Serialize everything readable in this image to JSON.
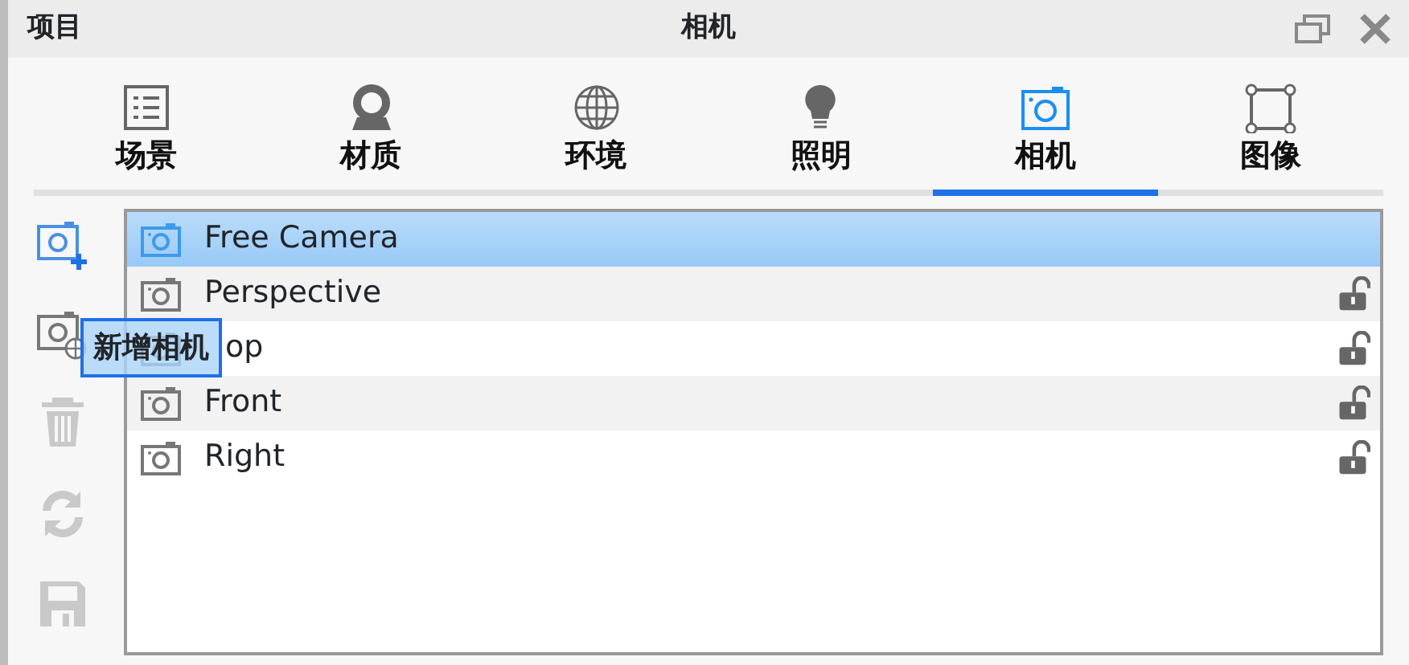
{
  "title_bar": {
    "left_label": "项目",
    "title": "相机"
  },
  "tabs": [
    {
      "label": "场景",
      "kind": "list",
      "selected": false
    },
    {
      "label": "材质",
      "kind": "material",
      "selected": false
    },
    {
      "label": "环境",
      "kind": "globe",
      "selected": false
    },
    {
      "label": "照明",
      "kind": "bulb",
      "selected": false
    },
    {
      "label": "相机",
      "kind": "camera",
      "selected": true
    },
    {
      "label": "图像",
      "kind": "frame",
      "selected": false
    }
  ],
  "toolbar": [
    {
      "kind": "add-camera",
      "disabled": false
    },
    {
      "kind": "camera-globe",
      "disabled": false
    },
    {
      "kind": "trash",
      "disabled": true
    },
    {
      "kind": "refresh",
      "disabled": true
    },
    {
      "kind": "save",
      "disabled": true
    }
  ],
  "tooltip": "新增相机",
  "cameras": [
    {
      "name": "Free Camera",
      "selected": true
    },
    {
      "name": "Perspective",
      "selected": false,
      "locked": false
    },
    {
      "name": "op",
      "selected": false,
      "locked": false
    },
    {
      "name": "Front",
      "selected": false,
      "locked": false
    },
    {
      "name": "Right",
      "selected": false,
      "locked": false
    }
  ]
}
